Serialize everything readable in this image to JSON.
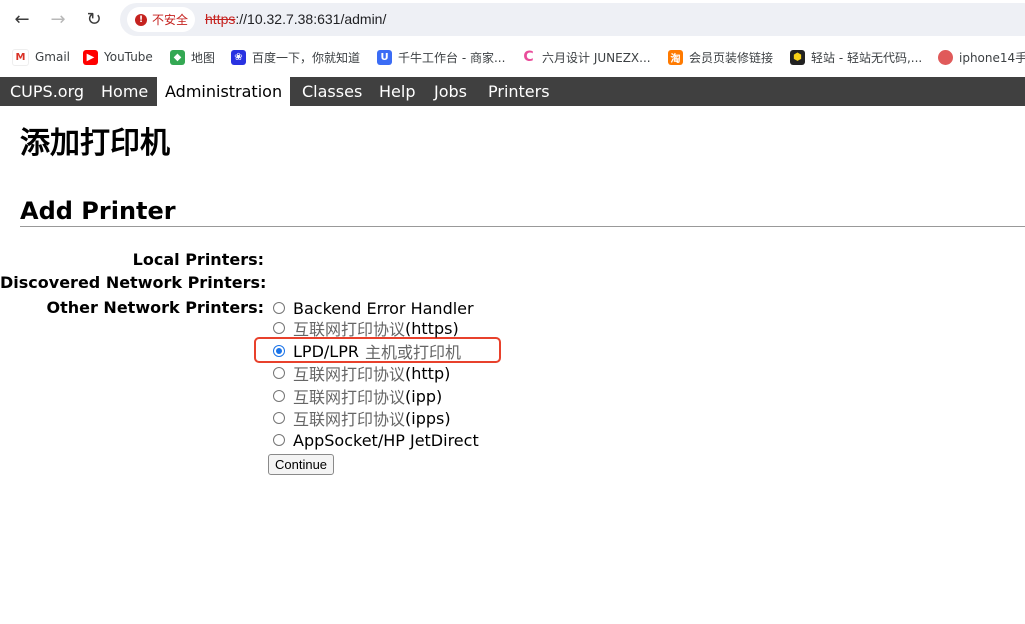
{
  "browser": {
    "security_label": "不安全",
    "url_scheme": "https",
    "url_rest": "://10.32.7.38:631/admin/"
  },
  "bookmarks": [
    {
      "label": "Gmail",
      "icon": "gmail-icon",
      "color": "#d93025"
    },
    {
      "label": "YouTube",
      "icon": "youtube-icon",
      "color": "#ff0000"
    },
    {
      "label": "地图",
      "icon": "maps-icon",
      "color": "#34a853"
    },
    {
      "label": "百度一下，你就知道",
      "icon": "baidu-icon",
      "color": "#2932e1"
    },
    {
      "label": "千牛工作台 - 商家...",
      "icon": "qianniu-icon",
      "color": "#3b6cf5"
    },
    {
      "label": "六月设计 JUNEZX...",
      "icon": "junezx-icon",
      "color": "#e94c9a"
    },
    {
      "label": "会员页装修链接",
      "icon": "taobao-icon",
      "color": "#ff7a00"
    },
    {
      "label": "轻站 - 轻站无代码,...",
      "icon": "qingzhan-icon",
      "color": "#222222"
    },
    {
      "label": "iphone14手",
      "icon": "iphone-bookmark-icon",
      "color": "#e05a5a"
    }
  ],
  "cups_nav": {
    "items": [
      "CUPS.org",
      "Home",
      "Administration",
      "Classes",
      "Help",
      "Jobs",
      "Printers"
    ],
    "active": "Administration"
  },
  "page": {
    "title": "添加打印机",
    "section_title": "Add Printer",
    "labels": {
      "local": "Local Printers:",
      "discovered": "Discovered Network Printers:",
      "other": "Other Network Printers:"
    },
    "options": [
      {
        "en": "Backend Error Handler",
        "cn": "",
        "suffix": "",
        "checked": false
      },
      {
        "en": "",
        "cn": "互联网打印协议",
        "suffix": " (https)",
        "checked": false
      },
      {
        "en": "LPD/LPR ",
        "cn": "主机或打印机",
        "suffix": "",
        "checked": true
      },
      {
        "en": "",
        "cn": "互联网打印协议",
        "suffix": " (http)",
        "checked": false
      },
      {
        "en": "",
        "cn": "互联网打印协议",
        "suffix": " (ipp)",
        "checked": false
      },
      {
        "en": "",
        "cn": "互联网打印协议",
        "suffix": " (ipps)",
        "checked": false
      },
      {
        "en": "AppSocket/HP JetDirect",
        "cn": "",
        "suffix": "",
        "checked": false
      }
    ],
    "continue_label": "Continue"
  },
  "colors": {
    "header_bg": "#404040",
    "highlight_border": "#e8412c",
    "insecure_red": "#c5221f"
  }
}
